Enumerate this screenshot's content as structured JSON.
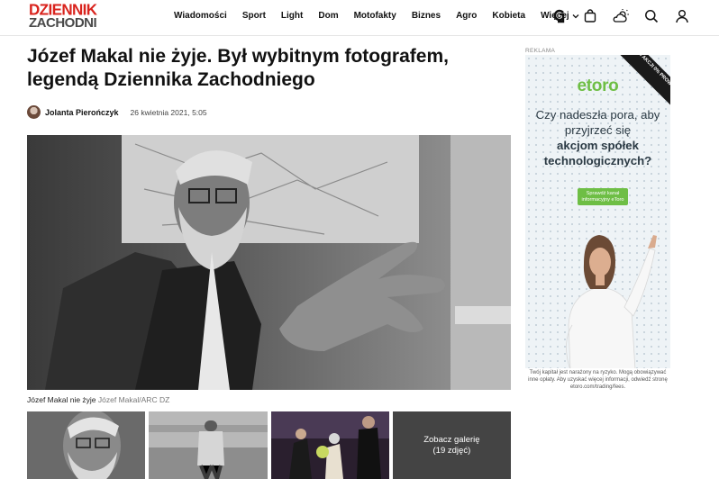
{
  "header": {
    "logo_line1": "DZIENNIK",
    "logo_line2": "ZACHODNI",
    "nav": [
      "Wiadomości",
      "Sport",
      "Light",
      "Dom",
      "Motofakty",
      "Biznes",
      "Agro",
      "Kobieta"
    ],
    "more_label": "Więcej",
    "icons": [
      "g-logo-icon",
      "bag-icon",
      "weather-icon",
      "search-icon",
      "user-icon"
    ]
  },
  "article": {
    "title": "Józef Makal nie żyje. Był wybitnym fotografem, legendą Dziennika Zachodniego",
    "author": "Jolanta Pierończyk",
    "date": "26 kwietnia 2021, 5:05",
    "caption": "Józef Makal nie żyje",
    "caption_source": "Józef Makal/ARC DZ"
  },
  "gallery": {
    "line1": "Zobacz galerię",
    "line2": "(19 zdjęć)"
  },
  "ad": {
    "label": "REKLAMA",
    "brand": "etoro",
    "corner": "100% AKCJI 0% PROWIZJI",
    "headline_line1": "Czy nadeszła pora, aby",
    "headline_line2": "przyjrzeć się",
    "headline_bold1": "akcjom spółek",
    "headline_bold2": "technologicznych?",
    "cta": "Sprawdź kanał informacyjny eToro",
    "disclaimer": "Twój kapitał jest narażony na ryzyko. Mogą obowiązywać inne opłaty. Aby uzyskać więcej informacji, odwiedź stronę etoro.com/trading/fees."
  },
  "colors": {
    "brand_red": "#d9231d",
    "etoro_green": "#6ebe45"
  }
}
